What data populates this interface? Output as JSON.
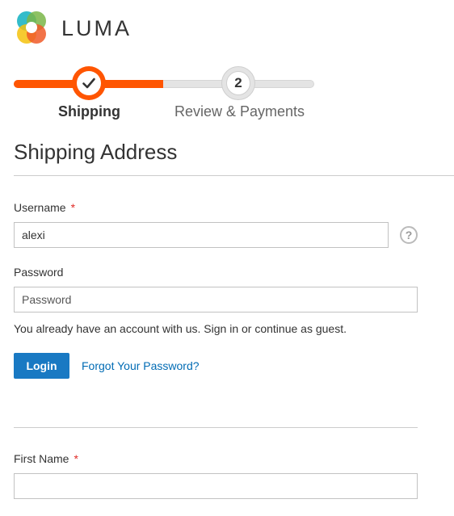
{
  "brand": {
    "name": "LUMA"
  },
  "progress": {
    "steps": [
      {
        "number": "1",
        "label": "Shipping",
        "state": "complete"
      },
      {
        "number": "2",
        "label": "Review & Payments",
        "state": "upcoming"
      }
    ],
    "accent_color": "#ff5501"
  },
  "shipping": {
    "title": "Shipping Address",
    "username_label": "Username",
    "username_value": "alexi",
    "required_marker": "*",
    "help_glyph": "?",
    "password_label": "Password",
    "password_placeholder": "Password",
    "account_note": "You already have an account with us. Sign in or continue as guest.",
    "login_label": "Login",
    "forgot_label": "Forgot Your Password?",
    "first_name_label": "First Name",
    "first_name_value": ""
  },
  "colors": {
    "primary_button": "#1979c3",
    "link": "#006bb4",
    "required": "#e02b27"
  }
}
